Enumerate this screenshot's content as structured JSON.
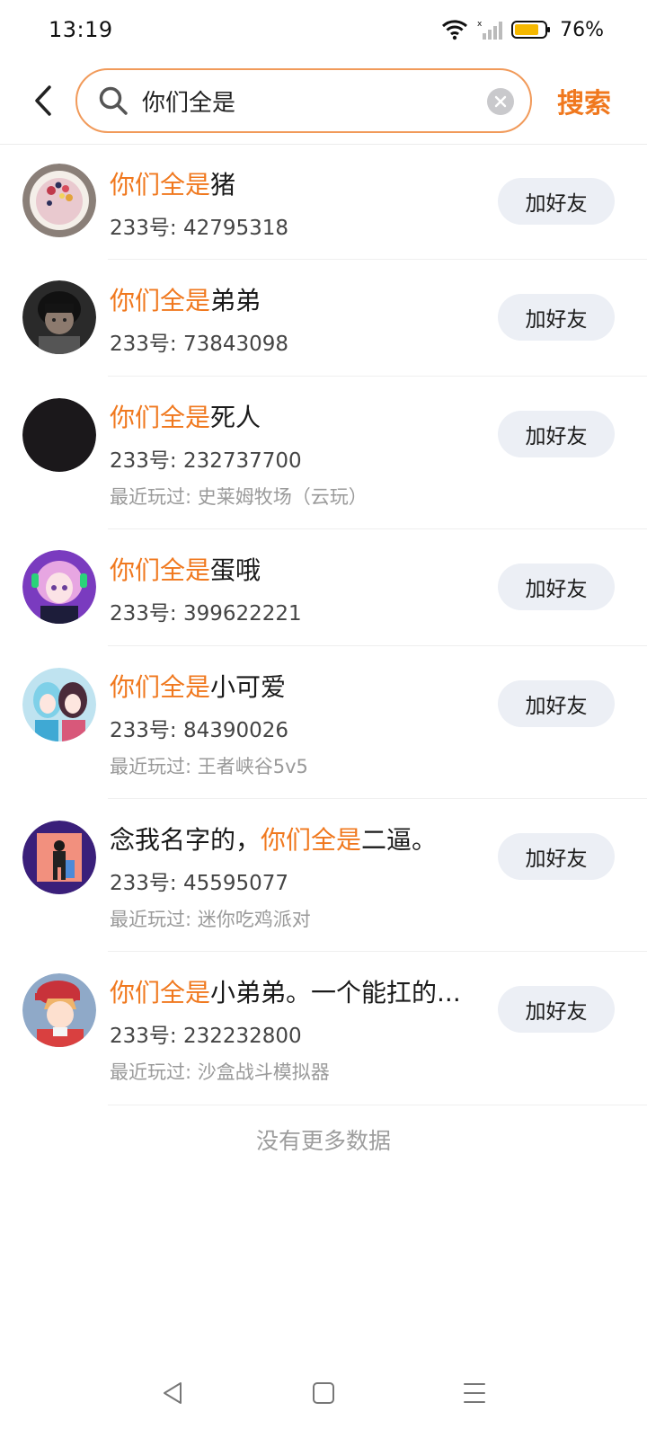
{
  "status_bar": {
    "time": "13:19",
    "battery": "76%"
  },
  "search": {
    "query": "你们全是",
    "search_label": "搜索"
  },
  "colors": {
    "accent": "#f0781e",
    "search_border": "#f19a5a",
    "button_bg": "#eceff5"
  },
  "results": [
    {
      "highlight": "你们全是",
      "prefix": "",
      "rest": "猪",
      "id_text": "233号: 42795318",
      "recent": "",
      "add_label": "加好友",
      "avatar": "dessert-bowl"
    },
    {
      "highlight": "你们全是",
      "prefix": "",
      "rest": "弟弟",
      "id_text": "233号: 73843098",
      "recent": "",
      "add_label": "加好友",
      "avatar": "dark-child-photo"
    },
    {
      "highlight": "你们全是",
      "prefix": "",
      "rest": "死人",
      "id_text": "233号: 232737700",
      "recent": "最近玩过: 史莱姆牧场（云玩）",
      "add_label": "加好友",
      "avatar": "black-circle"
    },
    {
      "highlight": "你们全是",
      "prefix": "",
      "rest": "蛋哦",
      "id_text": "233号: 399622221",
      "recent": "",
      "add_label": "加好友",
      "avatar": "anime-purple-hair"
    },
    {
      "highlight": "你们全是",
      "prefix": "",
      "rest": "小可爱",
      "id_text": "233号: 84390026",
      "recent": "最近玩过: 王者峡谷5v5",
      "add_label": "加好友",
      "avatar": "anime-two-girls"
    },
    {
      "highlight": "你们全是",
      "prefix": "念我名字的，",
      "rest": "二逼。",
      "id_text": "233号: 45595077",
      "recent": "最近玩过: 迷你吃鸡派对",
      "add_label": "加好友",
      "avatar": "figure-pink-blue"
    },
    {
      "highlight": "你们全是",
      "prefix": "",
      "rest": "小弟弟。一个能扛的...",
      "id_text": "233号: 232232800",
      "recent": "最近玩过: 沙盒战斗模拟器",
      "add_label": "加好友",
      "avatar": "anime-boy-red-cap"
    }
  ],
  "footer": {
    "no_more": "没有更多数据"
  }
}
